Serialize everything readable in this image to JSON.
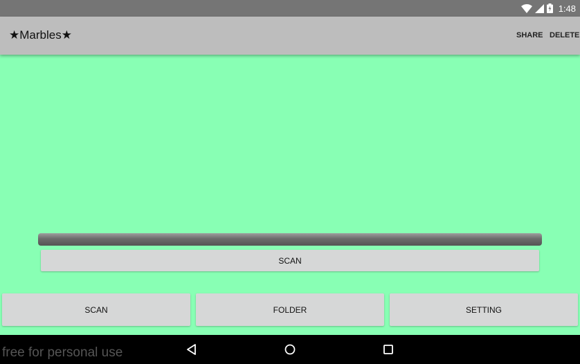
{
  "status_bar": {
    "time": "1:48",
    "icons": [
      "wifi-icon",
      "signal-icon",
      "battery-charging-icon"
    ]
  },
  "app_bar": {
    "title": "★Marbles★",
    "actions": {
      "share": "SHARE",
      "delete": "DELETE"
    }
  },
  "main": {
    "progress_percent": 100,
    "scan_button": "SCAN"
  },
  "bottom_buttons": {
    "scan": "SCAN",
    "folder": "FOLDER",
    "setting": "SETTING"
  },
  "nav_bar": {
    "watermark": "free for personal use",
    "icons": [
      "back-icon",
      "home-icon",
      "recents-icon"
    ]
  },
  "colors": {
    "background": "#88ffb4",
    "app_bar": "#bdbdbd",
    "status_bar": "#757575",
    "button": "#d6d7d7",
    "nav_bar": "#000000"
  }
}
